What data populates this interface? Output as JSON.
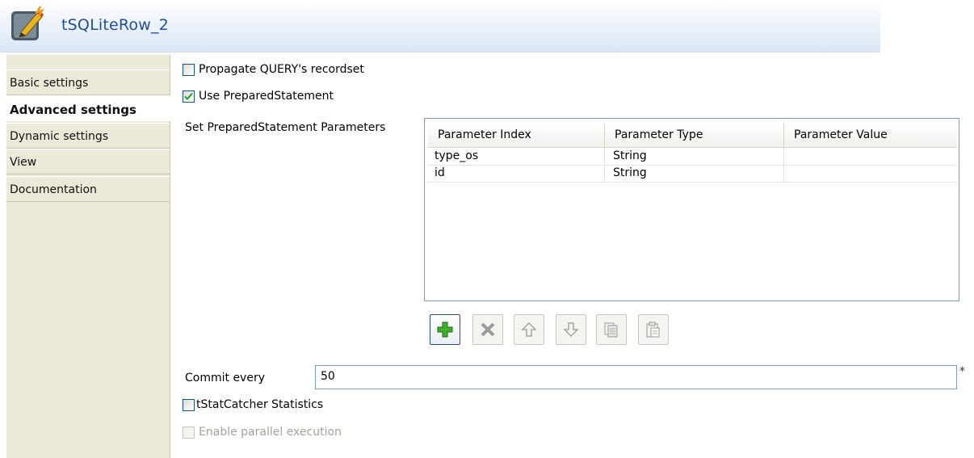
{
  "header": {
    "title": "tSQLiteRow_2",
    "icon": "edit-component-icon"
  },
  "sidebar": {
    "tabs": [
      {
        "label": "Basic settings",
        "active": false
      },
      {
        "label": "Advanced settings",
        "active": true
      },
      {
        "label": "Dynamic settings",
        "active": false
      },
      {
        "label": "View",
        "active": false
      },
      {
        "label": "Documentation",
        "active": false
      }
    ]
  },
  "options": {
    "propagate": {
      "label": "Propagate QUERY's recordset",
      "checked": false
    },
    "use_prepared": {
      "label": "Use PreparedStatement",
      "checked": true
    }
  },
  "params": {
    "label": "Set PreparedStatement Parameters",
    "columns": [
      "Parameter Index",
      "Parameter Type",
      "Parameter Value"
    ],
    "rows": [
      [
        "type_os",
        "String",
        ""
      ],
      [
        "id",
        "String",
        ""
      ]
    ]
  },
  "toolbar": {
    "buttons": [
      {
        "name": "add-icon",
        "enabled": true
      },
      {
        "name": "delete-icon",
        "enabled": false
      },
      {
        "name": "move-up-icon",
        "enabled": false
      },
      {
        "name": "move-down-icon",
        "enabled": false
      },
      {
        "name": "copy-icon",
        "enabled": false
      },
      {
        "name": "paste-icon",
        "enabled": false
      }
    ]
  },
  "commit": {
    "label": "Commit every",
    "value": "50",
    "required_marker": "*"
  },
  "stat_catcher": {
    "label": "tStatCatcher Statistics",
    "checked": false
  },
  "parallel": {
    "label": "Enable parallel execution",
    "checked": false,
    "enabled": false
  },
  "colors": {
    "title": "#1f4fa0",
    "sidebar_bg": "#ece9d8",
    "input_border": "#7f9db9",
    "check": "#21a121"
  }
}
